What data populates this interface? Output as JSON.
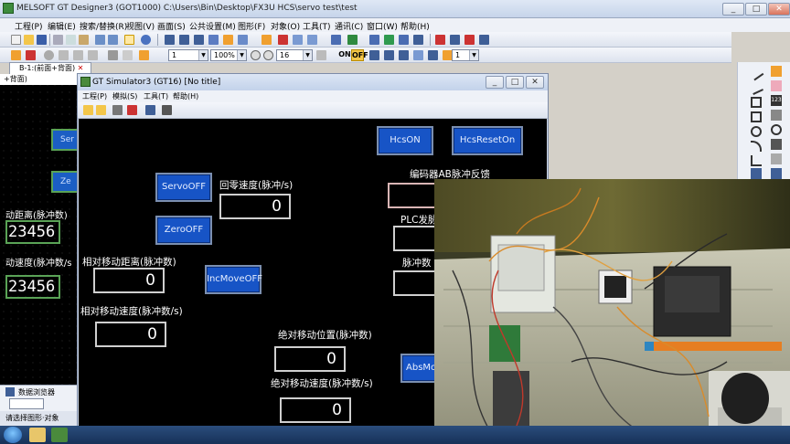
{
  "app": {
    "title": "MELSOFT GT Designer3 (GOT1000) C:\\Users\\Bin\\Desktop\\FX3U HCS\\servo test\\test",
    "menu": [
      "工程(P)",
      "编辑(E)",
      "搜索/替换(R)",
      "视图(V)",
      "画面(S)",
      "公共设置(M)",
      "图形(F)",
      "对象(O)",
      "工具(T)",
      "通讯(C)",
      "窗口(W)",
      "帮助(H)"
    ]
  },
  "toolbar": {
    "line_width": "1",
    "zoom": "100%",
    "font_size": "16",
    "on_label": "ON",
    "off_label": "OFF",
    "spin_value": "1"
  },
  "designer": {
    "tab_label": "B-1:(前面+背面)",
    "bg_tab": "+背面)",
    "btn1": "Ser",
    "btn2": "Ze",
    "label_distance": "动距离(脉冲数)",
    "value1": "23456",
    "label_speed": "动速度(脉冲数/s",
    "value2": "23456",
    "monitor_title": "数据浏览器",
    "status_text": "请选择图形·对象"
  },
  "simulator": {
    "title": "GT Simulator3 (GT16)  [No title]",
    "menu": [
      "工程(P)",
      "模拟(S)",
      "工具(T)",
      "帮助(H)"
    ],
    "buttons": {
      "hcs_on": "HcsON",
      "hcs_reset_on": "HcsResetOn",
      "servo_off": "ServoOFF",
      "zero_off": "ZeroOFF",
      "inc_move_off": "IncMoveOFF",
      "abs_move": "AbsMove"
    },
    "labels": {
      "home_speed": "回零速度(脉冲/s)",
      "encoder_feedback": "编码器AB脉冲反馈",
      "plc_pulse": "PLC发脉",
      "pulse_count": "脉冲数",
      "rel_distance": "相对移动距离(脉冲数)",
      "rel_speed": "相对移动速度(脉冲数/s)",
      "abs_position": "绝对移动位置(脉冲数)",
      "abs_speed": "绝对移动速度(脉冲数/s)"
    },
    "values": {
      "home_speed": "0",
      "rel_distance": "0",
      "rel_speed": "0",
      "abs_position": "0",
      "abs_speed": "0"
    }
  },
  "colors": {
    "hmi_button": "#1754c6",
    "hmi_bg": "#000000",
    "frame_green": "#5aa356"
  }
}
